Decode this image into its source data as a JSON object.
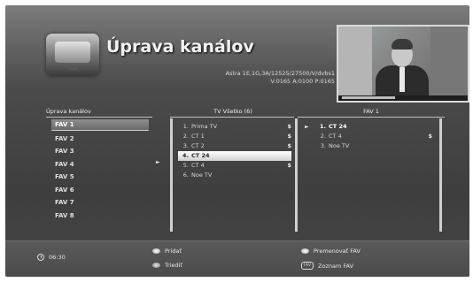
{
  "header": {
    "title": "Úprava kanálov",
    "sat_line1": "Astra 1E,1G,3A/12525/27500/V/dvbs1",
    "sat_line2": "V:0165  A:0100  P:0165"
  },
  "columns": {
    "left_header": "Úprava kanálov",
    "middle_header": "TV Všetko (6)",
    "right_header": "FAV 1"
  },
  "fav_list": [
    "FAV 1",
    "FAV 2",
    "FAV 3",
    "FAV 4",
    "FAV 5",
    "FAV 6",
    "FAV 7",
    "FAV 8"
  ],
  "all_channels": [
    {
      "num": "1.",
      "name": "Prima TV",
      "flag": "$"
    },
    {
      "num": "2.",
      "name": "CT 1",
      "flag": "$"
    },
    {
      "num": "3.",
      "name": "CT 2",
      "flag": "$"
    },
    {
      "num": "4.",
      "name": "CT 24",
      "flag": ""
    },
    {
      "num": "5.",
      "name": "CT 4",
      "flag": "$"
    },
    {
      "num": "6.",
      "name": "Noe TV",
      "flag": ""
    }
  ],
  "fav_channels": [
    {
      "num": "1.",
      "name": "CT 24",
      "flag": ""
    },
    {
      "num": "2.",
      "name": "CT 4",
      "flag": "$"
    },
    {
      "num": "3.",
      "name": "Noe TV",
      "flag": ""
    }
  ],
  "arrow_glyph": "►",
  "footer": {
    "clock": "06:30",
    "add": "Pridať",
    "sort": "Triediť",
    "rename": "Premenovať FAV",
    "fav_list": "Zoznam FAV",
    "fav_list_icon_text": "FAV"
  },
  "icons": {
    "clock": "clock-icon",
    "add": "red-button-icon",
    "sort": "green-button-icon",
    "rename": "yellow-button-icon",
    "fav_list": "fav-button-icon"
  }
}
